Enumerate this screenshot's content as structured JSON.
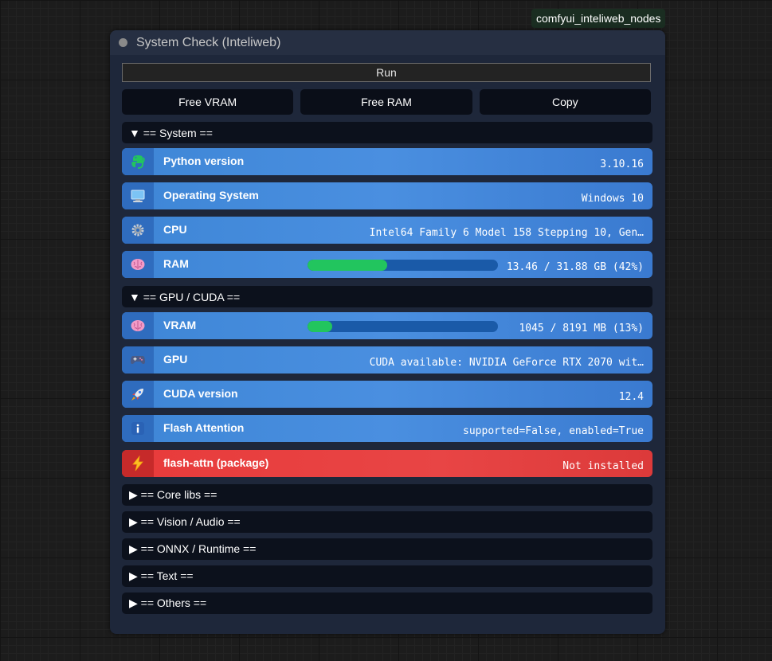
{
  "badge": "comfyui_inteliweb_nodes",
  "node": {
    "title": "System Check (Inteliweb)",
    "run_label": "Run",
    "actions": [
      "Free VRAM",
      "Free RAM",
      "Copy"
    ]
  },
  "sections": {
    "system": "▼ == System ==",
    "gpu": "▼ == GPU / CUDA ==",
    "core": "▶ == Core libs ==",
    "vision": "▶ == Vision / Audio ==",
    "onnx": "▶ == ONNX / Runtime ==",
    "text": "▶ == Text ==",
    "others": "▶ == Others =="
  },
  "rows": {
    "python": {
      "label": "Python version",
      "value": "3.10.16",
      "icon": "python-icon"
    },
    "os": {
      "label": "Operating System",
      "value": "Windows 10",
      "icon": "monitor-icon"
    },
    "cpu": {
      "label": "CPU",
      "value": "Intel64 Family 6 Model 158 Stepping 10, Gen…",
      "icon": "gear-icon"
    },
    "ram": {
      "label": "RAM",
      "value": "13.46 / 31.88 GB (42%)",
      "fraction": 0.42,
      "icon": "brain-icon"
    },
    "vram": {
      "label": "VRAM",
      "value": "1045 / 8191 MB (13%)",
      "fraction": 0.13,
      "icon": "brain-icon"
    },
    "gpu": {
      "label": "GPU",
      "value": "CUDA available: NVIDIA GeForce RTX 2070 wit…",
      "icon": "gamepad-icon"
    },
    "cuda": {
      "label": "CUDA version",
      "value": "12.4",
      "icon": "rocket-icon"
    },
    "flash": {
      "label": "Flash Attention",
      "value": "supported=False, enabled=True",
      "icon": "info-icon"
    },
    "flashpkg": {
      "label": "flash-attn (package)",
      "value": "Not installed",
      "icon": "lightning-icon"
    }
  },
  "colors": {
    "row_blue": "#4a8fe0",
    "row_red": "#e84545",
    "bar_fill": "#22c55e",
    "bar_track": "#1a5aa8"
  }
}
